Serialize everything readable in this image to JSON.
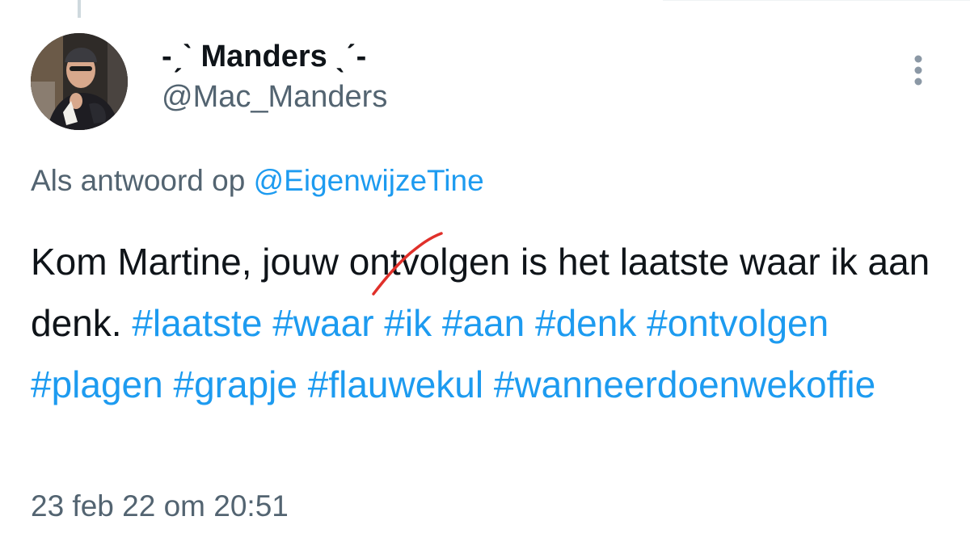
{
  "tweet": {
    "display_name": "-ˏˋ Manders ˎˊ-",
    "handle": "@Mac_Manders",
    "reply_prefix": "Als antwoord op",
    "reply_to": "@EigenwijzeTine",
    "text_segments": [
      {
        "type": "text",
        "value": "Kom Martine, jouw ontvolgen is het laatste waar ik aan denk. "
      },
      {
        "type": "hashtag",
        "value": "#laatste"
      },
      {
        "type": "text",
        "value": " "
      },
      {
        "type": "hashtag",
        "value": "#waar"
      },
      {
        "type": "text",
        "value": " "
      },
      {
        "type": "hashtag",
        "value": "#ik"
      },
      {
        "type": "text",
        "value": " "
      },
      {
        "type": "hashtag",
        "value": "#aan"
      },
      {
        "type": "text",
        "value": " "
      },
      {
        "type": "hashtag",
        "value": "#denk"
      },
      {
        "type": "text",
        "value": " "
      },
      {
        "type": "hashtag",
        "value": "#ontvolgen"
      },
      {
        "type": "text",
        "value": " "
      },
      {
        "type": "hashtag",
        "value": "#plagen"
      },
      {
        "type": "text",
        "value": " "
      },
      {
        "type": "hashtag",
        "value": "#grapje"
      },
      {
        "type": "text",
        "value": " "
      },
      {
        "type": "hashtag",
        "value": "#flauwekul"
      },
      {
        "type": "text",
        "value": " "
      },
      {
        "type": "hashtag",
        "value": "#wanneerdoenwekoffie"
      }
    ],
    "timestamp": "23 feb 22 om 20:51"
  },
  "icons": {
    "more": "more-vertical-icon",
    "avatar": "profile-photo",
    "annotation": "red-strike-mark"
  },
  "colors": {
    "link": "#1d9bf0",
    "text": "#0f1419",
    "secondary": "#536471",
    "strike": "#e0302a"
  }
}
